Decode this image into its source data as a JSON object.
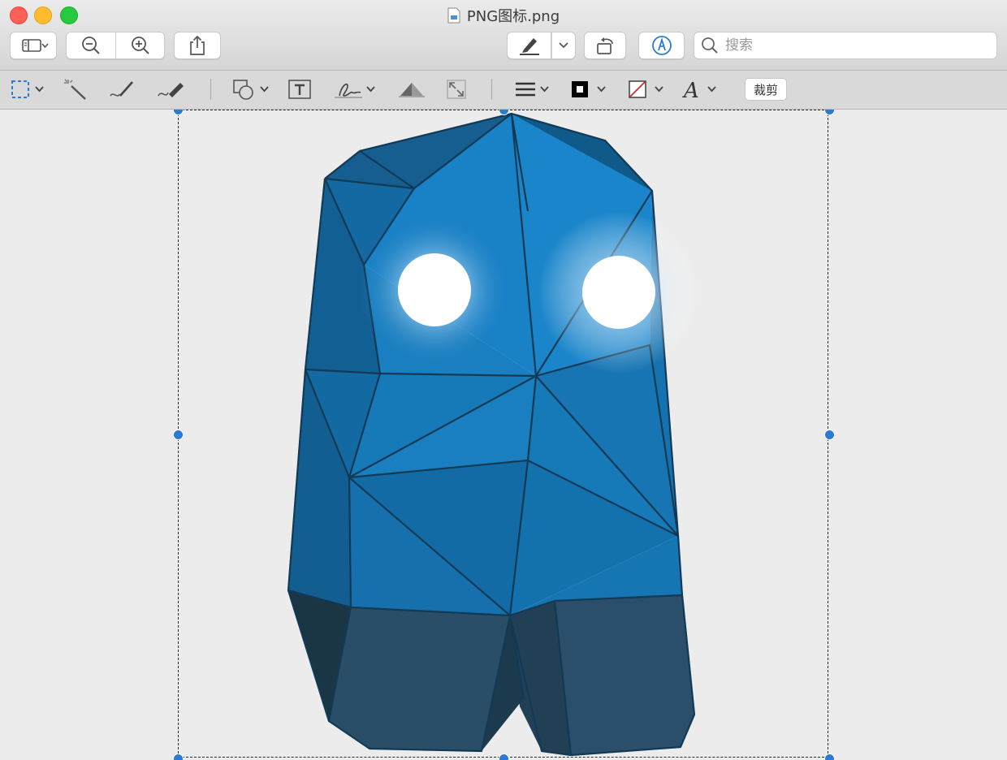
{
  "window": {
    "title": "PNG图标.png"
  },
  "toolbar": {
    "sidebar_icon": "sidebar-icon",
    "zoom_out_icon": "zoom-out-icon",
    "zoom_in_icon": "zoom-in-icon",
    "share_icon": "share-icon",
    "highlight_icon": "highlight-pen-icon",
    "rotate_icon": "rotate-icon",
    "markup_icon": "markup-icon",
    "search": {
      "placeholder": "搜索",
      "value": ""
    }
  },
  "markup": {
    "tools": [
      "rect-select-icon",
      "instant-alpha-icon",
      "sketch-icon",
      "draw-icon",
      "shapes-icon",
      "text-icon",
      "sign-icon",
      "adjust-color-icon",
      "adjust-size-icon",
      "line-style-icon",
      "border-color-icon",
      "fill-color-icon",
      "text-style-icon"
    ],
    "crop_label": "裁剪"
  },
  "colors": {
    "selection_handle": "#2a7bd1",
    "ghost_body": "#1577b8",
    "ghost_legs": "#2b4f6a",
    "eye_glow": "#ffffff"
  }
}
